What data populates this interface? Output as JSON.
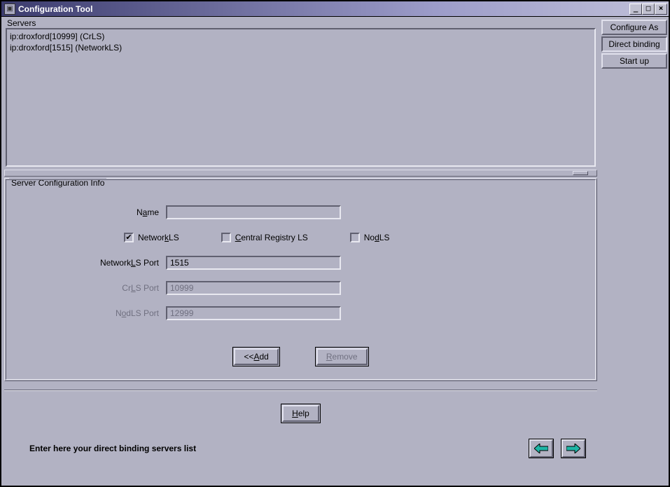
{
  "window": {
    "title": "Configuration Tool"
  },
  "sidebar": {
    "configure_as": "Configure As",
    "direct_binding": "Direct binding",
    "start_up": "Start up"
  },
  "servers": {
    "group_label": "Servers",
    "items": [
      "ip:droxford[10999] (CrLS)",
      "ip:droxford[1515] (NetworkLS)"
    ]
  },
  "config": {
    "group_label": "Server Configuration Info",
    "name_label_pre": "N",
    "name_label_u": "a",
    "name_label_post": "me",
    "name_value": "",
    "chk_network_pre": "Networ",
    "chk_network_u": "k",
    "chk_network_post": "LS",
    "chk_network_checked": true,
    "chk_central_pre": "",
    "chk_central_u": "C",
    "chk_central_post": "entral Registry LS",
    "chk_central_checked": false,
    "chk_nod_pre": "No",
    "chk_nod_u": "d",
    "chk_nod_post": "LS",
    "chk_nod_checked": false,
    "networkls_label_pre": "Network",
    "networkls_label_u": "L",
    "networkls_label_post": "S Port",
    "networkls_value": "1515",
    "crls_label_pre": "Cr",
    "crls_label_u": "L",
    "crls_label_post": "S Port",
    "crls_value": "10999",
    "nodls_label_pre": "N",
    "nodls_label_u": "o",
    "nodls_label_post": "dLS Port",
    "nodls_value": "12999",
    "add_pre": "<< ",
    "add_u": "A",
    "add_post": "dd",
    "remove_u": "R",
    "remove_post": "emove",
    "help_u": "H",
    "help_post": "elp"
  },
  "footer": {
    "hint": "Enter here your direct binding servers list"
  }
}
